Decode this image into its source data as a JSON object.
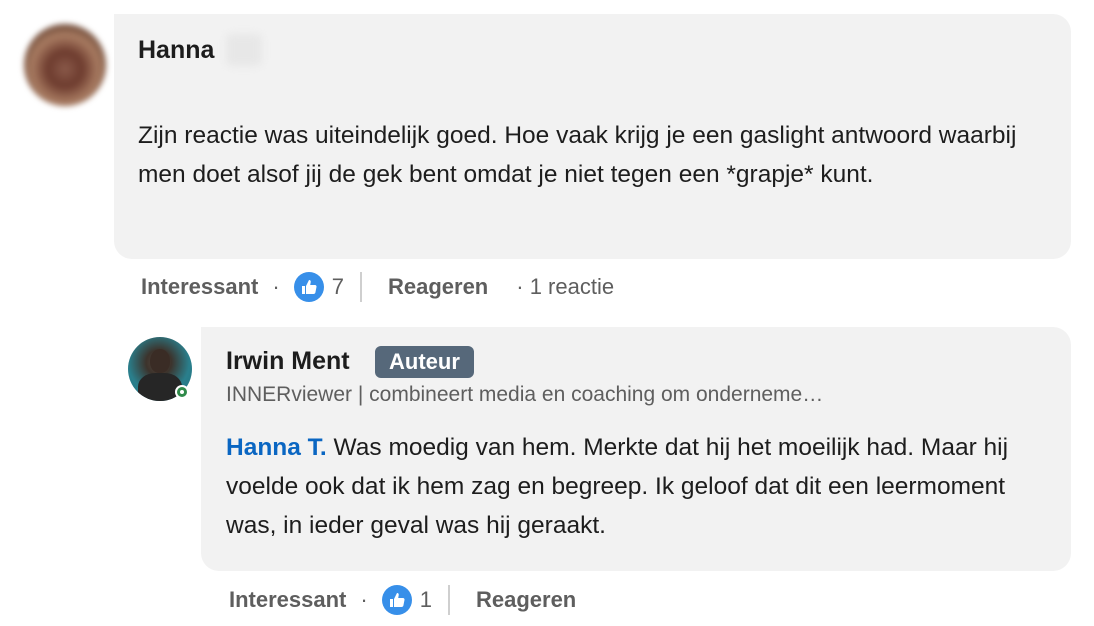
{
  "top_comment": {
    "author": "Hanna",
    "body": "Zijn reactie was uiteindelijk goed. Hoe vaak krijg je een gaslight antwoord waarbij men doet alsof jij de gek bent omdat je niet tegen een *grapje* kunt.",
    "actions": {
      "react_label": "Interessant",
      "separator": "·",
      "reaction_count": "7",
      "reply_label": "Reageren",
      "reply_count": "· 1 reactie"
    }
  },
  "reply_comment": {
    "author": "Irwin Ment",
    "badge": "Auteur",
    "headline": "INNERviewer | combineert media en coaching om onderneme…",
    "mention": "Hanna T.",
    "body": " Was moedig van hem. Merkte dat hij het moeilijk had. Maar hij voelde ook dat ik hem zag en begreep. Ik geloof dat dit een leermoment was, in ieder geval was hij geraakt.",
    "actions": {
      "react_label": "Interessant",
      "separator": "·",
      "reaction_count": "1",
      "reply_label": "Reageren"
    }
  },
  "colors": {
    "bubble": "#f2f2f2",
    "mention": "#0a66c2",
    "badge": "#56687a",
    "like": "#378fe9",
    "online": "#2f8a4a"
  },
  "icons": {
    "like": "thumbs-up-icon"
  }
}
